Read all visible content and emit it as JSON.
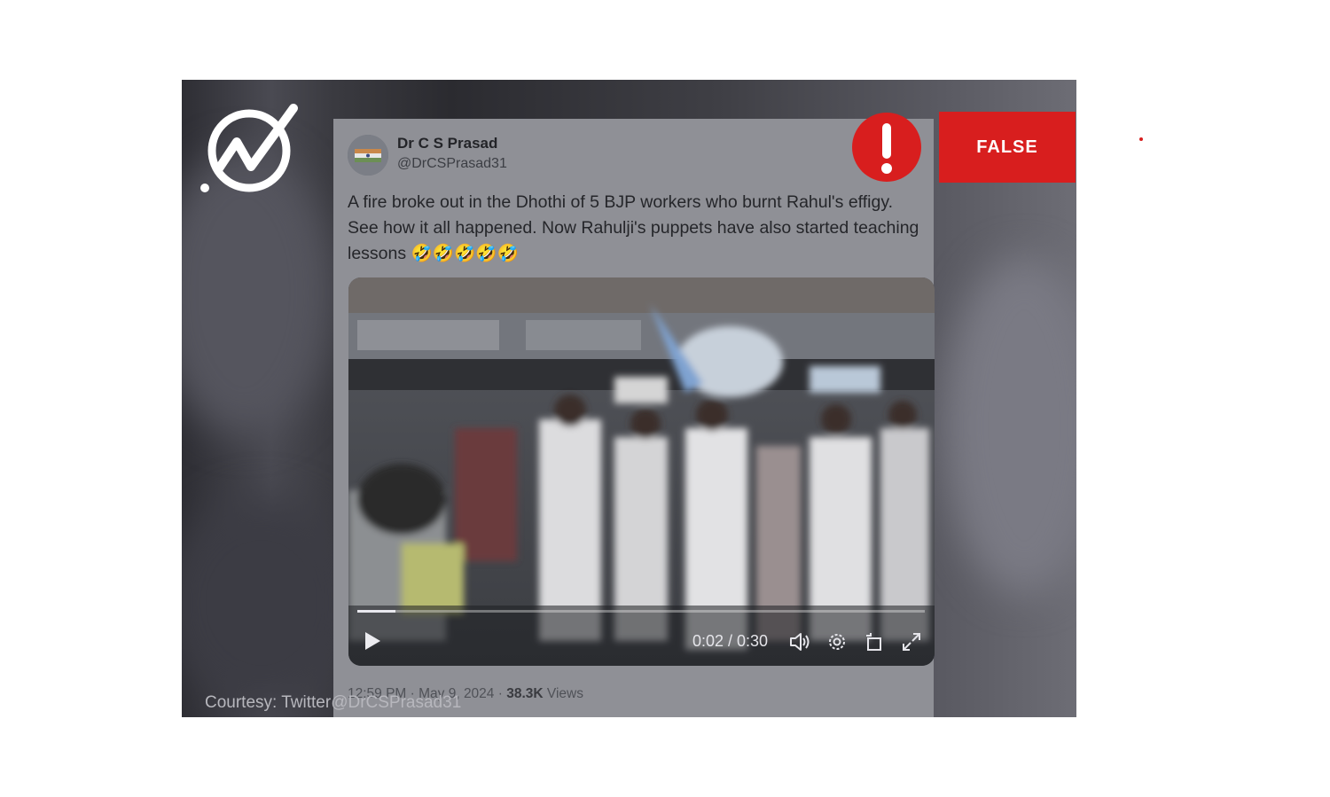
{
  "verdict": {
    "label": "FALSE",
    "color": "#d81e1e",
    "icon": "exclamation-icon"
  },
  "logo": {
    "icon": "fact-check-logo"
  },
  "tweet": {
    "author_name": "Dr C S Prasad",
    "author_handle": "@DrCSPrasad31",
    "more_icon": "···",
    "text": "A fire broke out in the Dhothi of 5 BJP workers who burnt Rahul's effigy. See how it all happened. Now Rahulji's puppets have also started teaching lessons 🤣🤣🤣🤣🤣",
    "timestamp": "12:59 PM · May 9, 2024 ·",
    "views_count": "38.3K",
    "views_label": "Views"
  },
  "video": {
    "time": "0:02 / 0:30",
    "progress": 0.067,
    "controls": [
      "play-icon",
      "volume-icon",
      "settings-icon",
      "rotate-icon",
      "fullscreen-icon"
    ]
  },
  "courtesy": "Courtesy: Twitter@DrCSPrasad31"
}
